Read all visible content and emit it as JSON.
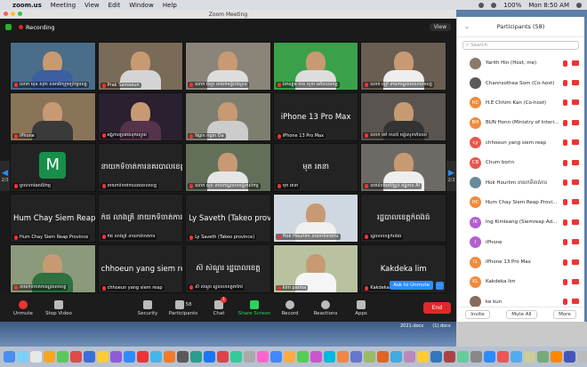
{
  "menubar": {
    "app": "zoom.us",
    "items": [
      "Meeting",
      "View",
      "Edit",
      "Window",
      "Help"
    ],
    "time": "Mon 8:50 AM",
    "battery": "100%"
  },
  "window": {
    "title": "Zoom Meeting"
  },
  "topbar": {
    "recording": "Recording",
    "view": "View"
  },
  "nav": {
    "left_page": "2/3",
    "right_page": "2/3"
  },
  "tiles": [
    {
      "name": "",
      "label": "លោក ឃុន សុភា សមាជិកក្រុមប្រឹក្សាខេត្ត",
      "kind": "video",
      "bg": "#4a6d8a",
      "shirt": "#3b5fa0"
    },
    {
      "name": "",
      "label": "Prak Samoeun",
      "kind": "video",
      "bg": "#7a6a58",
      "shirt": "#d4d4d4"
    },
    {
      "name": "",
      "label": "លោក ពិទ្យា នាយកមន្ទីរបរិស្ថាន",
      "kind": "video",
      "bg": "#8a8578",
      "shirt": "#ddd"
    },
    {
      "name": "",
      "label": "ឯកឧត្តម ចាន់ សុខា អភិបាលខេត្ត",
      "kind": "video",
      "bg": "#3aa04a",
      "shirt": "#ddd"
    },
    {
      "name": "",
      "label": "លោក ឡៅ នាយករដ្ឋបាលសាលាខេត្ត",
      "kind": "video",
      "bg": "#6a5e52",
      "shirt": "#eee"
    },
    {
      "name": "",
      "label": "iPhone",
      "kind": "video",
      "bg": "#8a7458",
      "shirt": "#3a3a3a"
    },
    {
      "name": "",
      "label": "អង្គភាពប្រឆាំងពុករលួយ",
      "kind": "video",
      "bg": "#2a2030",
      "shirt": "#55334a"
    },
    {
      "name": "",
      "label": "Ngin ngin Da",
      "kind": "video",
      "bg": "#7e7e70",
      "shirt": "#ccc"
    },
    {
      "name": "iPhone 13 Pro Max",
      "label": "iPhone 13 Pro Max",
      "kind": "name"
    },
    {
      "name": "",
      "label": "លោក ម៉ៅ ចាន់ឌី មន្ទីរសុខាភិបាល",
      "kind": "video",
      "bg": "#5a5450",
      "shirt": "#333"
    },
    {
      "name": "",
      "label": "ម្ចាស់ហាងអាជីវកម្ម",
      "kind": "avatar",
      "initial": "M"
    },
    {
      "name": "នាយកទីចាត់ការនគរបាលខេត្ត",
      "label": "នាយកទីចាត់ការនគរបាលខេត្ត",
      "kind": "name"
    },
    {
      "name": "",
      "label": "លោក សុខ នាយករដ្ឋបាលមន្ទីរកសិកម្ម",
      "kind": "video",
      "bg": "#62705a",
      "shirt": "#e5e5e5"
    },
    {
      "name": "មុត រតនា",
      "label": "មុត រតនា",
      "kind": "name"
    },
    {
      "name": "",
      "label": "បាត់ដំបងអភិវឌ្ឍន៍ អង្គភាព AI",
      "kind": "video",
      "bg": "#6d6a66",
      "shirt": "#eee"
    },
    {
      "name": "Hum Chay Siem Reap Province",
      "label": "Hum Chay Siem Reap Province",
      "kind": "name"
    },
    {
      "name": "កំផ លាងគ្រី នាយកទីចាត់ការ",
      "label": "កំផ លាងគ្រី នាយកទីចាត់ការ",
      "kind": "name"
    },
    {
      "name": "Ly Saveth (Takeo province)",
      "label": "Ly Saveth (Takeo province)",
      "kind": "name"
    },
    {
      "name": "",
      "label": "Hok Hourlim នាយកទីចាត់ការ",
      "kind": "video",
      "bg": "#cfd8e0",
      "shirt": "#f0f0f0"
    },
    {
      "name": "រដ្ឋបាលខេត្តកំពង់ធំ",
      "label": "រដ្ឋបាលខេត្តកំពង់ធំ",
      "kind": "name"
    },
    {
      "name": "",
      "label": "នាយកទីចាត់ការរដ្ឋបាលខេត្ត",
      "kind": "video",
      "bg": "#8a9a7a",
      "shirt": "#2e7040"
    },
    {
      "name": "chhoeun yang siem reap",
      "label": "chhoeun yang siem reap",
      "kind": "name"
    },
    {
      "name": "ស៊ សំណួរ រដ្ឋបាលខេត្ត",
      "label": "ស៊ សំណួរ រដ្ឋបាលខេត្តតាកែវ",
      "kind": "name"
    },
    {
      "name": "",
      "label": "kim panha",
      "kind": "video",
      "bg": "#b9c2a0",
      "shirt": "#f5f5f5"
    },
    {
      "name": "Kakdeka lim",
      "label": "Kakdeka lim",
      "kind": "name",
      "ask": "Ask to Unmute"
    }
  ],
  "toolbar": {
    "unmute": "Unmute",
    "stop_video": "Stop Video",
    "security": "Security",
    "participants": "Participants",
    "participants_count": "58",
    "chat": "Chat",
    "chat_badge": "1",
    "share": "Share Screen",
    "record": "Record",
    "reactions": "Reactions",
    "apps": "Apps",
    "end": "End"
  },
  "panel": {
    "title": "Participants (58)",
    "search_placeholder": "Search",
    "participants": [
      {
        "initials": "",
        "name": "Yarith Hin (Host, me)",
        "color": "#8a7a6a"
      },
      {
        "initials": "",
        "name": "Channsothea Som (Co-host)",
        "color": "#5a5a5a"
      },
      {
        "initials": "HC",
        "name": "H.E Chhim Kan (Co-host)",
        "color": "#f08a3c"
      },
      {
        "initials": "BH",
        "name": "BUN Honn (Ministry of Interi...",
        "color": "#f08a3c"
      },
      {
        "initials": "cy",
        "name": "chhoeun yang siem reap",
        "color": "#e8554e"
      },
      {
        "initials": "CB",
        "name": "Chum borin",
        "color": "#e8554e"
      },
      {
        "initials": "",
        "name": "Hok Hourlim នាយកទីចាត់ការ",
        "color": "#6a8a9a"
      },
      {
        "initials": "HC",
        "name": "Hum Chay Siem Reap Provinc...",
        "color": "#f08a3c"
      },
      {
        "initials": "IK",
        "name": "Ing Kimleang (Siemreap Adm...",
        "color": "#b25fd0"
      },
      {
        "initials": "I",
        "name": "iPhone",
        "color": "#b25fd0"
      },
      {
        "initials": "I1",
        "name": "iPhone 13 Pro Max",
        "color": "#f08a3c"
      },
      {
        "initials": "KL",
        "name": "Kakdeka lim",
        "color": "#f08a3c"
      },
      {
        "initials": "",
        "name": "ke kun",
        "color": "#8a6a5a"
      }
    ],
    "invite": "Invite",
    "mute_all": "Mute All",
    "more": "More"
  },
  "desktop": {
    "files": [
      "2021.docx",
      "(1).docx"
    ]
  }
}
